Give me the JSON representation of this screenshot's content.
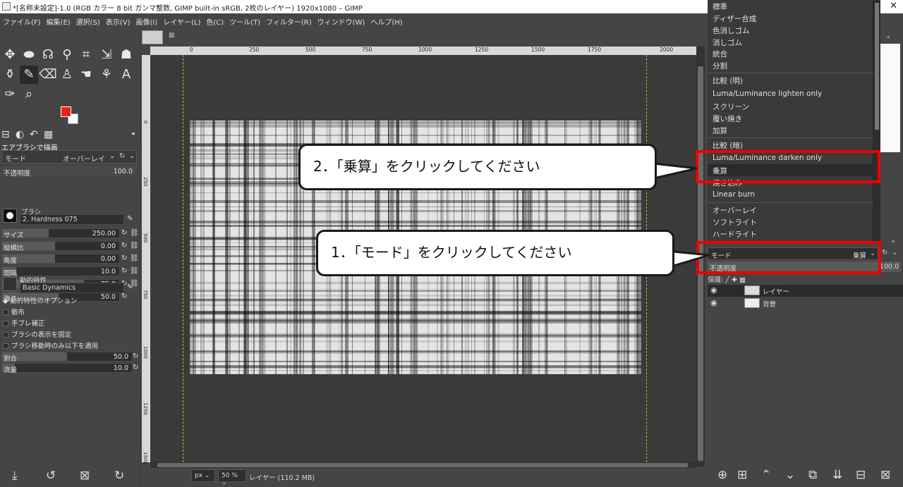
{
  "window": {
    "title": "*[名称未設定]-1.0 (RGB カラー 8 bit ガンマ整数, GIMP built-in sRGB, 2枚のレイヤー) 1920x1080 – GIMP",
    "close_glyph": "✕"
  },
  "menu": [
    "ファイル(F)",
    "編集(E)",
    "選択(S)",
    "表示(V)",
    "画像(I)",
    "レイヤー(L)",
    "色(C)",
    "ツール(T)",
    "フィルター(R)",
    "ウィンドウ(W)",
    "ヘルプ(H)"
  ],
  "colors": {
    "foreground": "#ee2020",
    "background": "#ffffff",
    "annotation_red": "#ee0000"
  },
  "tool_options": {
    "title": "エアブラシで描画",
    "mode_label": "モード",
    "mode_value": "オーバーレイ",
    "opacity": {
      "label": "不透明度",
      "value": "100.0"
    },
    "brush": {
      "label": "ブラシ",
      "name": "2. Hardness 075"
    },
    "size": {
      "label": "サイズ",
      "value": "250.00"
    },
    "aspect": {
      "label": "縦横比",
      "value": "0.00"
    },
    "angle": {
      "label": "角度",
      "value": "0.00"
    },
    "spacing": {
      "label": "間隔",
      "value": "10.0"
    },
    "hardness": {
      "label": "硬さ",
      "value": "75.0"
    },
    "force": {
      "label": "強さ",
      "value": "50.0"
    },
    "dynamics": {
      "label": "動的特性",
      "name": "Basic Dynamics"
    },
    "dynamics_options": "動的特性のオプション",
    "scatter": "散布",
    "smooth": "手ブレ補正",
    "lock_brush": "ブラシの表示を固定",
    "incremental": "ブラシ移動時のみ以下を適用",
    "rate": {
      "label": "割合",
      "value": "50.0"
    },
    "flow": {
      "label": "流量",
      "value": "10.0"
    }
  },
  "ruler": {
    "h_ticks": [
      "0",
      "250",
      "500",
      "750",
      "1000",
      "1250",
      "1500",
      "1750",
      "2000"
    ],
    "v_ticks": [
      "0",
      "250",
      "500",
      "750",
      "1000",
      "1250",
      "1500"
    ]
  },
  "status": {
    "unit": "px",
    "zoom": "50 %",
    "text": "レイヤー (110.2 MB)"
  },
  "mode_dropdown": {
    "groups": [
      [
        "標準",
        "ディザー合成",
        "色消しゴム",
        "消しゴム",
        "統合",
        "分割"
      ],
      [
        "比較 (明)",
        "Luma/Luminance lighten only",
        "スクリーン",
        "覆い焼き",
        "加算"
      ],
      [
        "比較 (暗)",
        "Luma/Luminance darken only",
        "乗算",
        "焼き込み",
        "Linear burn"
      ],
      [
        "オーバーレイ",
        "ソフトライト",
        "ハードライト"
      ]
    ],
    "selected": "乗算"
  },
  "layers_panel": {
    "mode_label": "モード",
    "mode_value": "乗算",
    "opacity_label": "不透明度",
    "opacity_value": "100.0",
    "protect_label": "保護:",
    "layers": [
      {
        "name": "レイヤー",
        "selected": true
      },
      {
        "name": "背景",
        "selected": false
      }
    ]
  },
  "annotations": {
    "step1": "1．「モード」をクリックしてください",
    "step2": "2．「乗算」をクリックしてください"
  }
}
